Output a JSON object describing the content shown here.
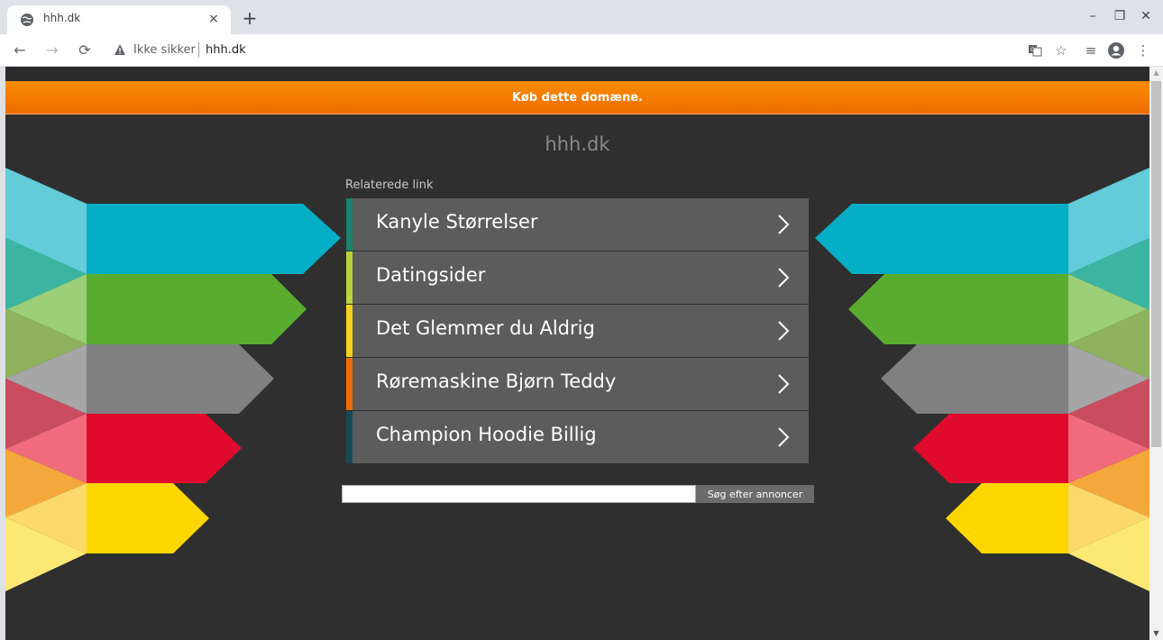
{
  "browser": {
    "tab_title": "hhh.dk",
    "tab_close": "×",
    "new_tab": "+",
    "security_text": "Ikke sikker",
    "url": "hhh.dk",
    "minimize": "–",
    "restore": "❐",
    "close": "✕"
  },
  "page": {
    "banner": "Køb dette domæne.",
    "domain": "hhh.dk",
    "related_label": "Relaterede link",
    "links": [
      {
        "label": "Kanyle Størrelser",
        "color": "#1b7f6e"
      },
      {
        "label": "Datingsider",
        "color": "#b8d23a"
      },
      {
        "label": "Det Glemmer du Aldrig",
        "color": "#f3d21a"
      },
      {
        "label": "Røremaskine Bjørn Teddy",
        "color": "#ef6c00"
      },
      {
        "label": "Champion Hoodie Billig",
        "color": "#174a57"
      }
    ],
    "search_button": "Søg efter annoncer"
  },
  "colors": {
    "cyan": "#04aec4",
    "green": "#5aac2f",
    "gray": "#808080",
    "red": "#e00b2c",
    "yellow": "#ffd700",
    "orange": "#f98a00"
  }
}
